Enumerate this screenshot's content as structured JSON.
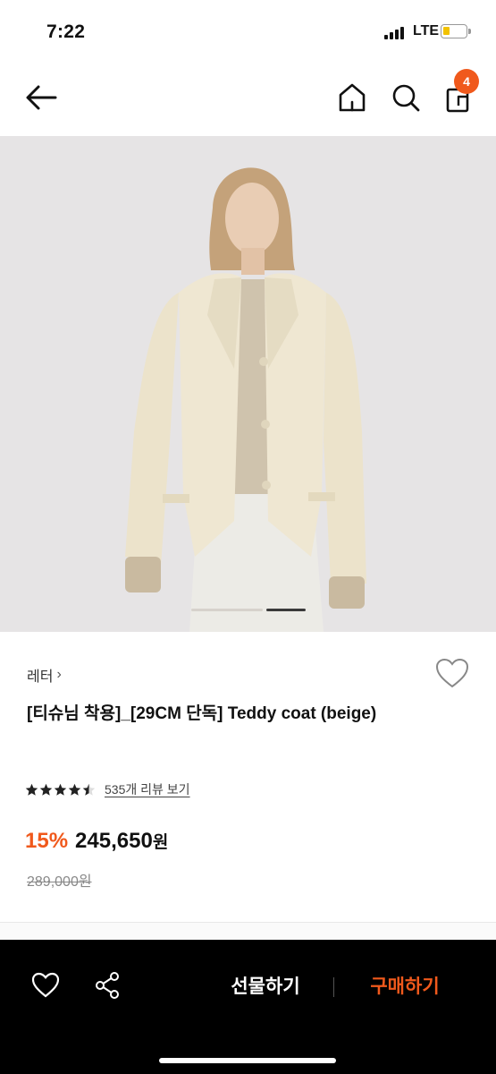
{
  "status_bar": {
    "time": "7:22",
    "network": "LTE",
    "battery_icon": "battery-low-icon",
    "signal_icon": "signal-bars-icon"
  },
  "nav": {
    "back_icon": "arrow-left-icon",
    "home_icon": "home-icon",
    "search_icon": "search-icon",
    "cart_icon": "shopping-bag-icon",
    "cart_count": "4"
  },
  "product": {
    "image_alt_icon": "product-photo",
    "image_count": 2,
    "current_image": 2,
    "brand": "레터",
    "brand_chevron": "›",
    "title": "[티슈님 착용]_[29CM 단독] Teddy coat (beige)",
    "rating": 4.5,
    "review_link": "535개 리뷰 보기",
    "discount": "15%",
    "price": "245,650",
    "price_unit": "원",
    "original_price": "289,000원",
    "wish_icon": "heart-outline-icon"
  },
  "bottom_bar": {
    "like_icon": "heart-outline-icon",
    "share_icon": "share-icon",
    "gift_label": "선물하기",
    "buy_label": "구매하기"
  },
  "colors": {
    "accent": "#f0591c",
    "bottom_bar": "#000000",
    "image_bg": "#e6e4e5",
    "coat": "#f1ead7"
  }
}
